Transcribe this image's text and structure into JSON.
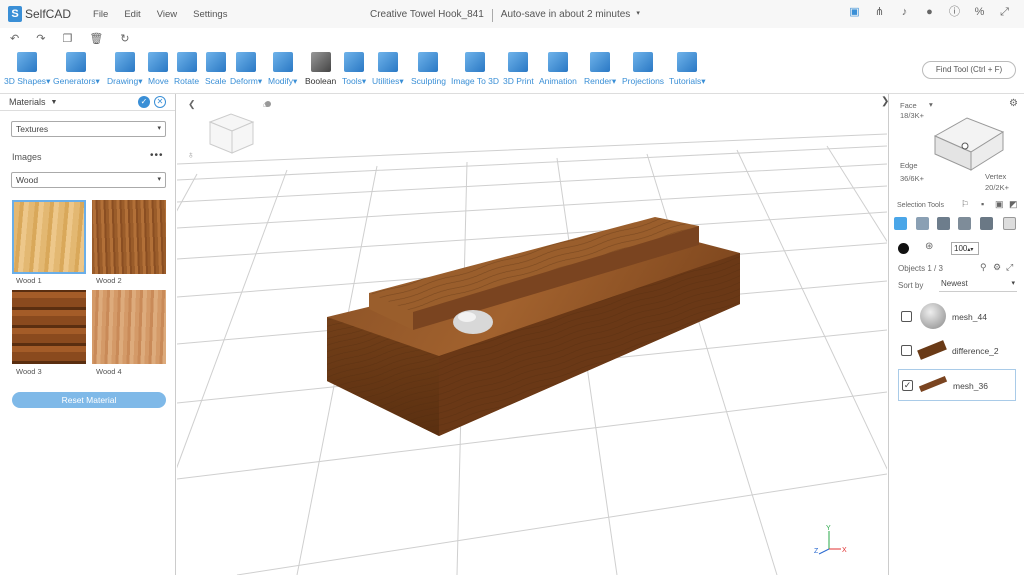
{
  "app": {
    "name": "SelfCAD"
  },
  "menu": [
    "File",
    "Edit",
    "View",
    "Settings"
  ],
  "document": {
    "title": "Creative Towel Hook_841",
    "autosave": "Auto-save in about 2 minutes"
  },
  "toolbar": {
    "tools": [
      "3D Shapes",
      "Generators",
      "Drawing",
      "Move",
      "Rotate",
      "Scale",
      "Deform",
      "Modify",
      "Boolean",
      "Tools",
      "Utilities",
      "Sculpting",
      "Image To 3D",
      "3D Print",
      "Animation",
      "Render",
      "Projections",
      "Tutorials"
    ],
    "find_tool": "Find Tool (Ctrl + F)"
  },
  "left_panel": {
    "title": "Materials",
    "category_select": "Textures",
    "images_label": "Images",
    "image_select": "Wood",
    "swatches": [
      "Wood 1",
      "Wood 2",
      "Wood 3",
      "Wood 4"
    ],
    "reset_label": "Reset Material"
  },
  "right_panel": {
    "face_label": "Face",
    "face_count": "18/3K+",
    "edge_label": "Edge",
    "edge_count": "36/6K+",
    "vertex_label": "Vertex",
    "vertex_count": "20/2K+",
    "selection_tools": "Selection Tools",
    "size_value": "100",
    "objects_label": "Objects 1 / 3",
    "sort_label": "Sort by",
    "sort_value": "Newest",
    "objects": [
      {
        "name": "mesh_44",
        "checked": false
      },
      {
        "name": "difference_2",
        "checked": false
      },
      {
        "name": "mesh_36",
        "checked": true
      }
    ]
  },
  "axes": {
    "x": "X",
    "y": "Y",
    "z": "Z"
  },
  "colors": {
    "accent": "#3a8fd6",
    "wood_dark": "#6b3d1a",
    "wood_light": "#a0652e"
  }
}
